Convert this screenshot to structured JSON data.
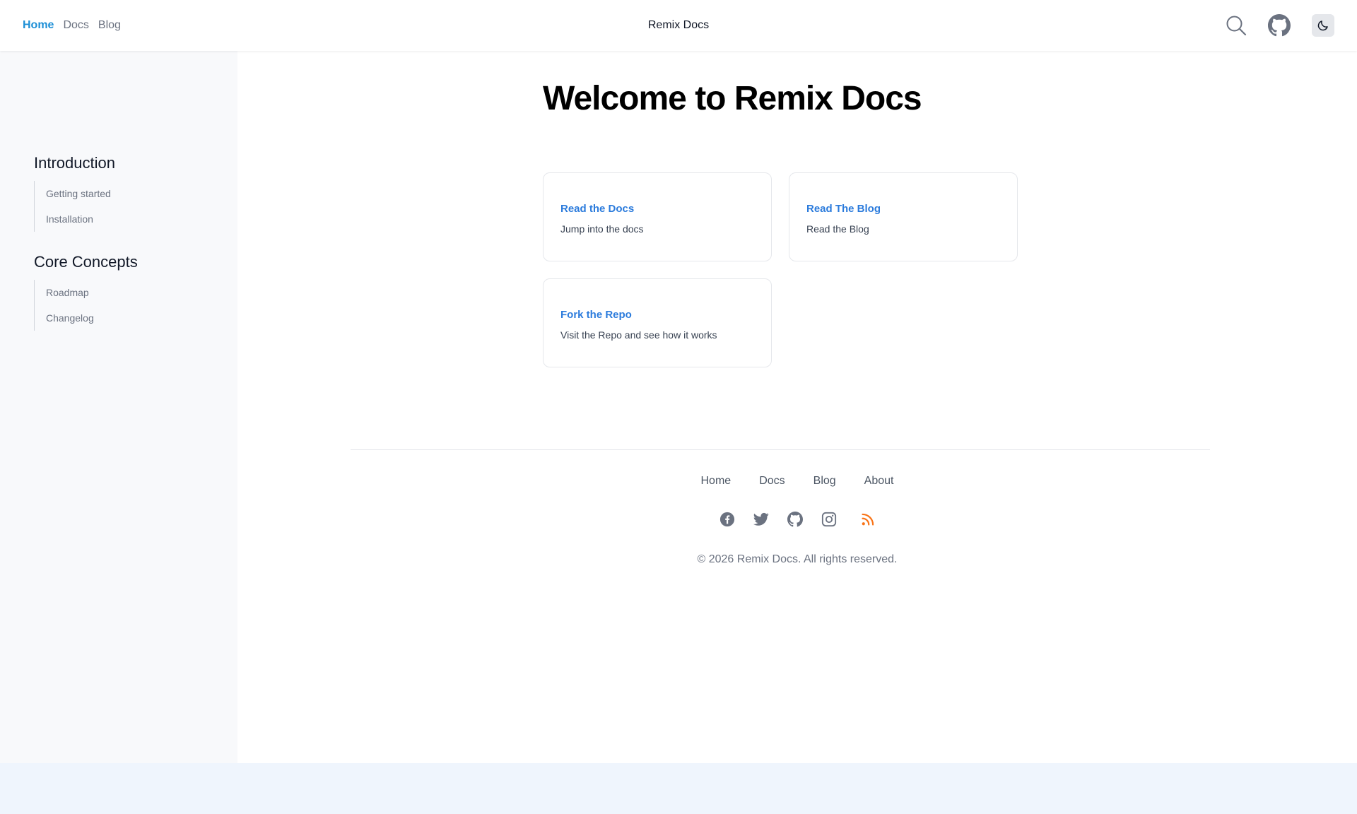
{
  "topbar": {
    "nav": [
      {
        "label": "Home",
        "active": true
      },
      {
        "label": "Docs",
        "active": false
      },
      {
        "label": "Blog",
        "active": false
      }
    ],
    "site_title": "Remix Docs",
    "icons": [
      "search-icon",
      "github-icon",
      "moon-icon"
    ]
  },
  "sidebar": {
    "sections": [
      {
        "title": "Introduction",
        "items": [
          "Getting started",
          "Installation"
        ]
      },
      {
        "title": "Core Concepts",
        "items": [
          "Roadmap",
          "Changelog"
        ]
      }
    ]
  },
  "main": {
    "title": "Welcome to Remix Docs",
    "cards": [
      {
        "title": "Read the Docs",
        "description": "Jump into the docs"
      },
      {
        "title": "Read The Blog",
        "description": "Read the Blog"
      },
      {
        "title": "Fork the Repo",
        "description": "Visit the Repo and see how it works"
      }
    ]
  },
  "footer": {
    "nav": [
      "Home",
      "Docs",
      "Blog",
      "About"
    ],
    "social_icons": [
      "facebook-icon",
      "twitter-icon",
      "github-icon",
      "instagram-icon",
      "rss-icon"
    ],
    "copyright": "© 2026 Remix Docs. All rights reserved.",
    "colors": {
      "link_active": "#1d8fd6",
      "card_title": "#2b7bdc",
      "rss": "#f97316"
    }
  }
}
